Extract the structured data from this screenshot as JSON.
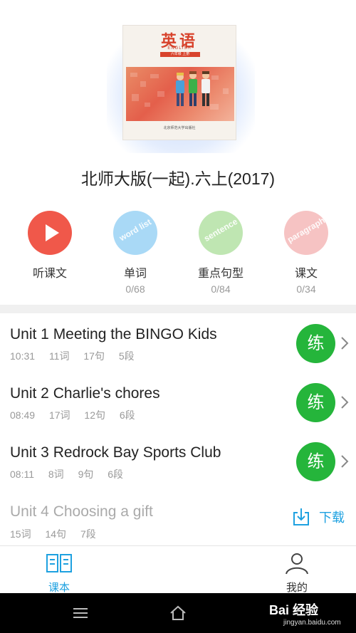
{
  "book": {
    "cover": {
      "title": "英语",
      "subtitle": "ENGLISH",
      "grade_tag": "六年级 上册",
      "publisher": "北京师范大学出版社"
    },
    "title": "北师大版(一起).六上(2017)"
  },
  "features": [
    {
      "label": "听课文",
      "count": "",
      "icon": "play-icon",
      "color": "#f0584a"
    },
    {
      "label": "单词",
      "count": "0/68",
      "icon": "word-list-icon",
      "color": "#a9d9f6",
      "badge": "word list"
    },
    {
      "label": "重点句型",
      "count": "0/84",
      "icon": "sentence-icon",
      "color": "#bfe6b2",
      "badge": "sentence"
    },
    {
      "label": "课文",
      "count": "0/34",
      "icon": "paragraph-icon",
      "color": "#f6c3c3",
      "badge": "paragraph"
    }
  ],
  "units": [
    {
      "title": "Unit 1 Meeting the BINGO Kids",
      "duration": "10:31",
      "words": "11词",
      "sentences": "17句",
      "paragraphs": "5段",
      "action": "练"
    },
    {
      "title": "Unit 2 Charlie's chores",
      "duration": "08:49",
      "words": "17词",
      "sentences": "12句",
      "paragraphs": "6段",
      "action": "练"
    },
    {
      "title": "Unit 3 Redrock Bay Sports Club",
      "duration": "08:11",
      "words": "8词",
      "sentences": "9句",
      "paragraphs": "6段",
      "action": "练"
    },
    {
      "title": "Unit 4 Choosing a gift",
      "words": "15词",
      "sentences": "14句",
      "paragraphs": "7段",
      "action": "下载"
    }
  ],
  "tabbar": {
    "textbook": "课本",
    "mine": "我的",
    "active_color": "#1ea1e0"
  },
  "watermark": {
    "brand": "Bai 经验",
    "url": "jingyan.baidu.com"
  },
  "colors": {
    "practice_green": "#25b53b",
    "accent_blue": "#1ea1e0"
  }
}
